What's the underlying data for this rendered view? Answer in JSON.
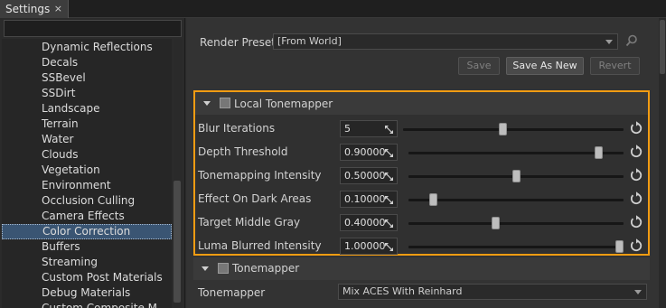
{
  "tab": {
    "title": "Settings",
    "close_glyph": "×"
  },
  "left_panel": {
    "search": {
      "placeholder": ""
    },
    "items": [
      "Dynamic Reflections",
      "Decals",
      "SSBevel",
      "SSDirt",
      "Landscape",
      "Terrain",
      "Water",
      "Clouds",
      "Vegetation",
      "Environment",
      "Occlusion Culling",
      "Camera Effects",
      "Color Correction",
      "Buffers",
      "Streaming",
      "Custom Post Materials",
      "Debug Materials",
      "Custom Composite M..."
    ],
    "selected_index": 12
  },
  "preset": {
    "label": "Render Preset:",
    "value": "[From World]",
    "icon": "search-icon",
    "buttons": {
      "save": "Save",
      "save_as_new": "Save As New",
      "revert": "Revert"
    }
  },
  "local_tonemapper": {
    "title": "Local Tonemapper",
    "accent_color": "#f39c12",
    "params": [
      {
        "label": "Blur Iterations",
        "value": "5",
        "level": 0.45
      },
      {
        "label": "Depth Threshold",
        "value": "0.90000",
        "level": 0.9
      },
      {
        "label": "Tonemapping Intensity",
        "value": "0.50000",
        "level": 0.5
      },
      {
        "label": "Effect On Dark Areas",
        "value": "0.10000",
        "level": 0.1
      },
      {
        "label": "Target Middle Gray",
        "value": "0.40000",
        "level": 0.4
      },
      {
        "label": "Luma Blurred Intensity",
        "value": "1.00000",
        "level": 1.0
      }
    ]
  },
  "tonemapper": {
    "title": "Tonemapper",
    "row_label": "Tonemapper",
    "value": "Mix ACES With Reinhard"
  }
}
